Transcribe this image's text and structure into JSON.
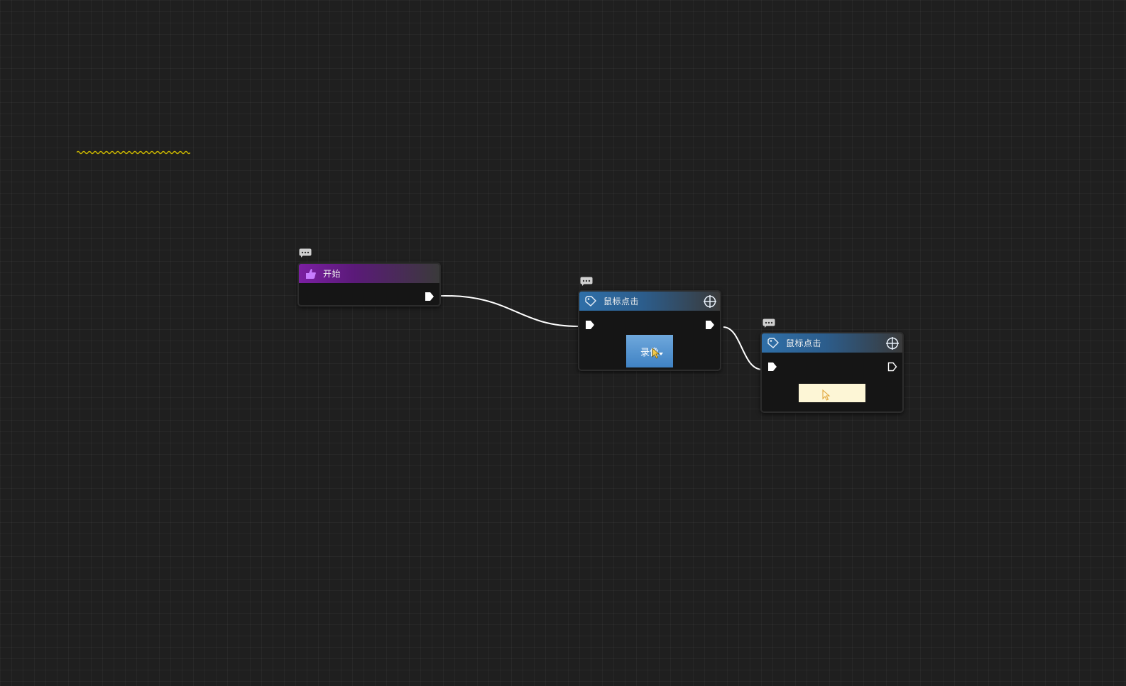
{
  "canvas": {
    "background": "#1f1f1f",
    "grid_color": "#2a2a2a",
    "wire_color": "#ffffff",
    "squiggle_color": "#c8b400"
  },
  "nodes": {
    "start": {
      "title": "开始",
      "icon": "pointing-hand-icon",
      "header_color_start": "#7b1fa2",
      "header_color_end": "#3a3a3a"
    },
    "click_1": {
      "title": "鼠标点击",
      "icon": "mouse-tag-icon",
      "target_icon": "crosshair-icon",
      "header_color_start": "#2f6fa8",
      "header_color_end": "#3a3a3a",
      "capture_label": "录像",
      "capture_state": "recording"
    },
    "click_2": {
      "title": "鼠标点击",
      "icon": "mouse-tag-icon",
      "target_icon": "crosshair-icon",
      "header_color_start": "#2f6fa8",
      "header_color_end": "#3a3a3a",
      "capture_label": "",
      "capture_state": "empty"
    }
  }
}
